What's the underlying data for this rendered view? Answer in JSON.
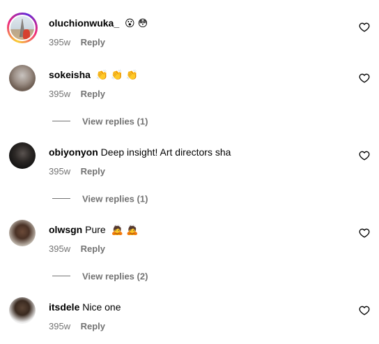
{
  "comments": [
    {
      "username": "oluchionwuka_",
      "text": "",
      "emojis": [
        "😮",
        "😳"
      ],
      "time": "395w",
      "reply_label": "Reply",
      "view_replies": ""
    },
    {
      "username": "sokeisha",
      "text": "",
      "emojis": [
        "👏",
        "👏",
        "👏"
      ],
      "time": "395w",
      "reply_label": "Reply",
      "view_replies": "View replies (1)"
    },
    {
      "username": "obiyonyon",
      "text": "Deep insight! Art directors sha",
      "emojis": [],
      "time": "395w",
      "reply_label": "Reply",
      "view_replies": "View replies (1)"
    },
    {
      "username": "olwsgn",
      "text": "Pure",
      "emojis": [
        "🙇",
        "🙇"
      ],
      "time": "395w",
      "reply_label": "Reply",
      "view_replies": "View replies (2)"
    },
    {
      "username": "itsdele",
      "text": "Nice one",
      "emojis": [],
      "time": "395w",
      "reply_label": "Reply",
      "view_replies": ""
    }
  ],
  "icons": {
    "like": "heart-icon"
  },
  "colors": {
    "secondary_text": "#737373",
    "story_ring": [
      "#f9ce34",
      "#ee2a7b",
      "#6228d7"
    ]
  }
}
